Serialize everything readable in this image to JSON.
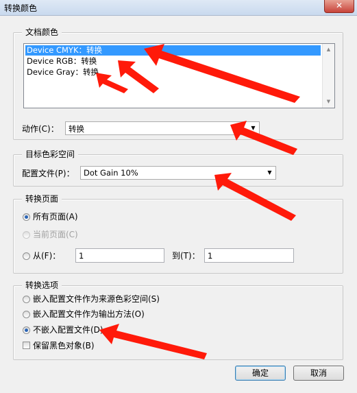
{
  "window": {
    "title": "转换颜色",
    "close_glyph": "✕"
  },
  "doc_color": {
    "legend": "文档颜色",
    "items": [
      {
        "label": "Device CMYK：转换",
        "selected": true
      },
      {
        "label": "Device RGB：转换",
        "selected": false
      },
      {
        "label": "Device Gray：转换",
        "selected": false
      }
    ],
    "action_label": "动作(C)：",
    "action_value": "转换"
  },
  "target_space": {
    "legend": "目标色彩空间",
    "profile_label": "配置文件(P)：",
    "profile_value": "Dot Gain 10%"
  },
  "convert_pages": {
    "legend": "转换页面",
    "all_pages": "所有页面(A)",
    "current_page": "当前页面(C)",
    "from_label": "从(F)：",
    "from_value": "1",
    "to_label": "到(T)：",
    "to_value": "1"
  },
  "convert_options": {
    "legend": "转换选项",
    "embed_source": "嵌入配置文件作为来源色彩空间(S)",
    "embed_output": "嵌入配置文件作为输出方法(O)",
    "no_embed": "不嵌入配置文件(D)",
    "preserve_black": "保留黑色对象(B)"
  },
  "buttons": {
    "ok": "确定",
    "cancel": "取消"
  },
  "colors": {
    "selection": "#3399ff",
    "annotation_arrow": "#ff1a0a"
  }
}
